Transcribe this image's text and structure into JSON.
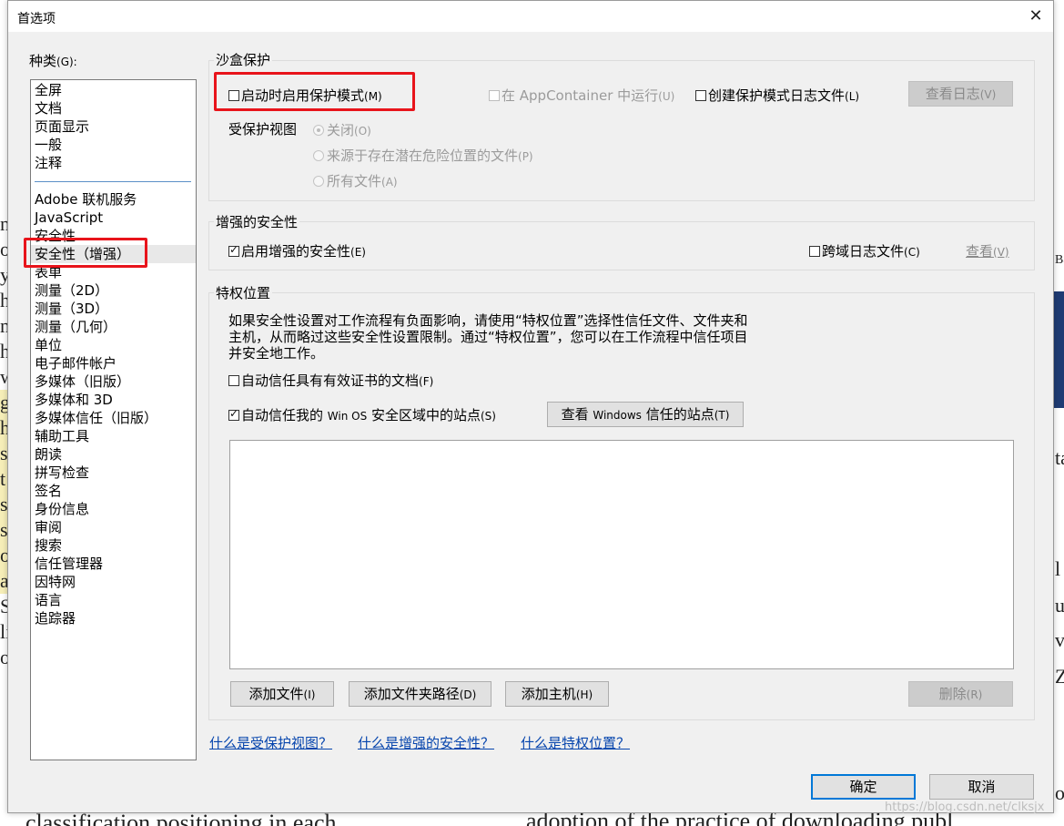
{
  "dialog": {
    "title": "首选项",
    "close_symbol": "✕"
  },
  "categories": {
    "label": "种类",
    "label_accel": "(G):",
    "items": [
      "全屏",
      "文档",
      "页面显示",
      "一般",
      "注释",
      "Adobe 联机服务",
      "JavaScript",
      "安全性",
      "安全性（增强）",
      "表单",
      "测量（2D）",
      "测量（3D）",
      "测量（几何）",
      "单位",
      "电子邮件帐户",
      "多媒体（旧版）",
      "多媒体和 3D",
      "多媒体信任（旧版）",
      "辅助工具",
      "朗读",
      "拼写检查",
      "签名",
      "身份信息",
      "审阅",
      "搜索",
      "信任管理器",
      "因特网",
      "语言",
      "追踪器"
    ],
    "selected": "安全性（增强）"
  },
  "sandbox": {
    "title": "沙盒保护",
    "protected_mode_label": "启动时启用保护模式",
    "protected_mode_accel": "(M)",
    "protected_mode_checked": false,
    "appcontainer_label": "在 AppContainer 中运行",
    "appcontainer_accel": "(U)",
    "log_label": "创建保护模式日志文件",
    "log_accel": "(L)",
    "view_log_label": "查看日志",
    "view_log_accel": "(V)",
    "protected_view_label": "受保护视图",
    "pv_off": "关闭",
    "pv_off_accel": "(O)",
    "pv_unsafe": "来源于存在潜在危险位置的文件",
    "pv_unsafe_accel": "(P)",
    "pv_all": "所有文件",
    "pv_all_accel": "(A)"
  },
  "enhanced": {
    "title": "增强的安全性",
    "enable_label": "启用增强的安全性",
    "enable_accel": "(E)",
    "enable_checked": true,
    "cross_domain_label": "跨域日志文件",
    "cross_domain_accel": "(C)",
    "view_label": "查看",
    "view_accel": "(V)"
  },
  "privileged": {
    "title": "特权位置",
    "desc_line1": "如果安全性设置对工作流程有负面影响，请使用“特权位置”选择性信任文件、文件夹和",
    "desc_line2": "主机，从而略过这些安全性设置限制。通过“特权位置”，您可以在工作流程中信任项目",
    "desc_line3": "并安全地工作。",
    "cert_label": "自动信任具有有效证书的文档",
    "cert_accel": "(F)",
    "winos_label_a": "自动信任我的 ",
    "winos_label_b": "Win OS",
    "winos_label_c": " 安全区域中的站点",
    "winos_accel": "(S)",
    "winos_checked": true,
    "view_sites_a": "查看 ",
    "view_sites_b": "Windows",
    "view_sites_c": " 信任的站点",
    "view_sites_accel": "(T)",
    "add_file": "添加文件",
    "add_file_accel": "(I)",
    "add_folder": "添加文件夹路径",
    "add_folder_accel": "(D)",
    "add_host": "添加主机",
    "add_host_accel": "(H)",
    "remove": "删除",
    "remove_accel": "(R)"
  },
  "links": {
    "pv": "什么是受保护视图？",
    "es": "什么是增强的安全性？",
    "pl": "什么是特权位置？"
  },
  "footer": {
    "ok": "确定",
    "cancel": "取消",
    "watermark": "https://blog.csdn.net/clksjx"
  },
  "background": {
    "bottom_text": "adoption of the practice of downloading publ",
    "bottom_text_left": "classification positioning in each",
    "right_fragments": [
      "Ba",
      "ta",
      "l",
      "u",
      "v",
      "Z",
      "or"
    ],
    "left_chars": [
      "n",
      "of",
      "y",
      "h",
      "n",
      "h",
      "w",
      "g",
      "h",
      "s",
      "t",
      "si",
      "sl",
      "o",
      "a",
      "S",
      "li",
      "o"
    ]
  },
  "colors": {
    "highlight": "#e8141b",
    "link": "#0645ad",
    "dialog_bg": "#f0f0f0",
    "separator": "#5b8fc7"
  }
}
